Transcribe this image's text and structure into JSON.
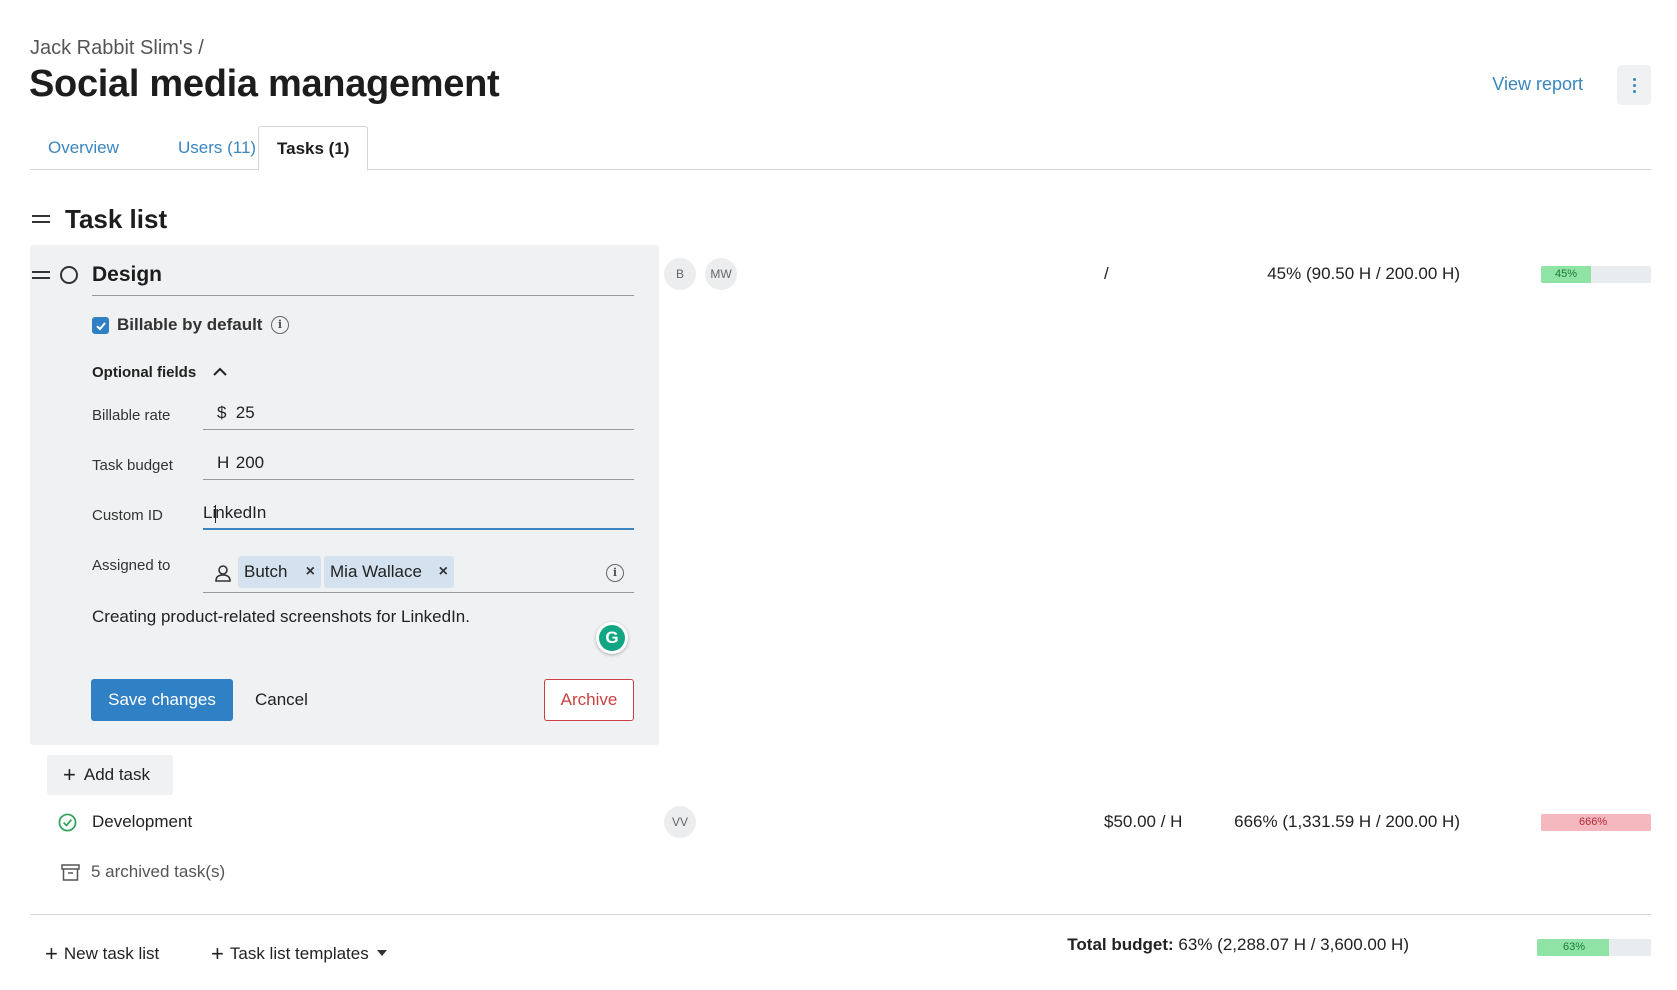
{
  "header": {
    "breadcrumb": "Jack Rabbit Slim's /",
    "title": "Social media management",
    "view_report": "View report",
    "menu_icon": "kebab-menu-icon"
  },
  "tabs": [
    {
      "label": "Overview",
      "active": false
    },
    {
      "label": "Users (11)",
      "active": false
    },
    {
      "label": "Tasks (1)",
      "active": true
    }
  ],
  "task_list": {
    "title": "Task list"
  },
  "edit_task": {
    "name": "Design",
    "billable_default_label": "Billable by default",
    "billable_default_checked": true,
    "optional_fields_label": "Optional fields",
    "billable_rate": {
      "label": "Billable rate",
      "prefix": "$",
      "value": "25"
    },
    "task_budget": {
      "label": "Task budget",
      "prefix": "H",
      "value": "200"
    },
    "custom_id": {
      "label": "Custom ID",
      "value_before_caret": "Li",
      "value_after_caret": "nkedIn"
    },
    "assigned_to": {
      "label": "Assigned to",
      "users": [
        "Butch",
        "Mia Wallace"
      ]
    },
    "description": "Creating product-related screenshots for LinkedIn.",
    "save_label": "Save changes",
    "cancel_label": "Cancel",
    "archive_label": "Archive",
    "avatars": [
      "B",
      "MW"
    ],
    "rate_text": "/",
    "budget_text": "45% (90.50 H / 200.00 H)",
    "budget_pct": 45,
    "budget_pct_label": "45%",
    "budget_color": "#8fe3a4"
  },
  "add_task_label": "Add task",
  "tasks": [
    {
      "name": "Development",
      "avatars": [
        "VV"
      ],
      "rate_text": "$50.00 / H",
      "budget_text": "666% (1,331.59 H / 200.00 H)",
      "budget_pct": 100,
      "budget_pct_label": "666%",
      "budget_color": "#f5b8bf"
    }
  ],
  "archived_label": "5 archived task(s)",
  "footer": {
    "new_task_list": "New task list",
    "templates": "Task list templates",
    "total_label": "Total budget:",
    "total_text": "63% (2,288.07 H / 3,600.00 H)",
    "total_pct": 63,
    "total_pct_label": "63%",
    "total_color": "#8fe3a4"
  },
  "colors": {
    "accent": "#2f80c4",
    "link": "#3a86c0",
    "danger": "#c9423f",
    "panel_bg": "#f0f1f2"
  }
}
